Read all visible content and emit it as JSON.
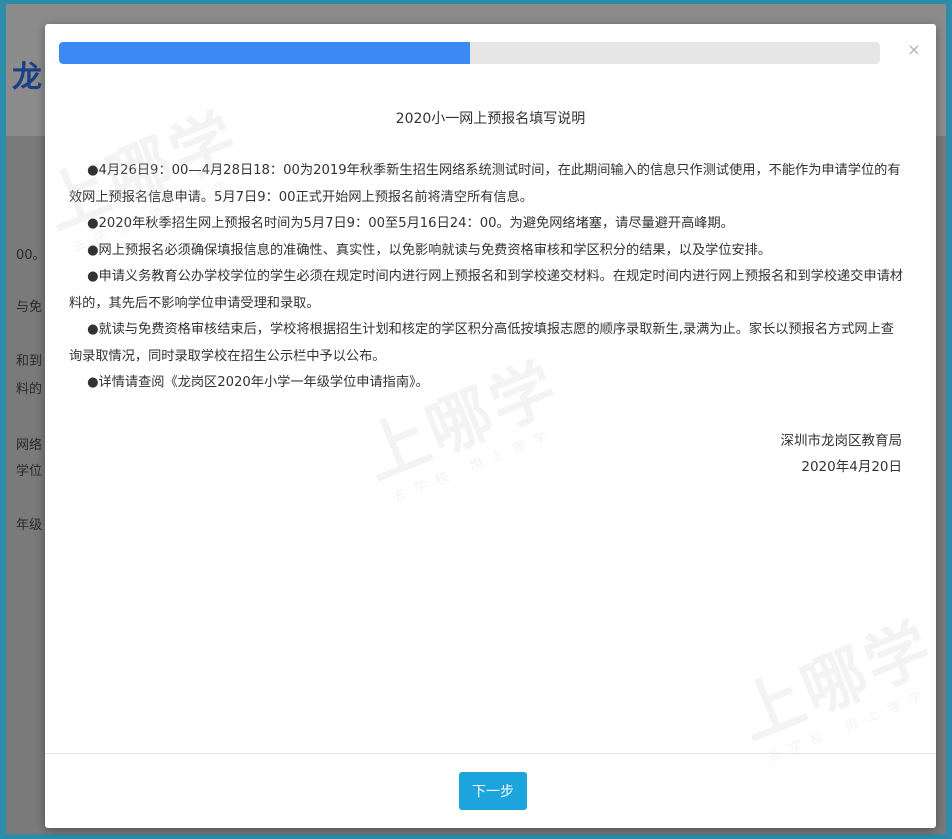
{
  "background": {
    "logo": "龙",
    "lines": [
      "00。",
      "与免",
      "和到",
      "料的",
      "网络",
      "学位",
      "年级"
    ]
  },
  "watermark": {
    "text": "上哪学",
    "subtext": "去学校 用上哪学"
  },
  "modal": {
    "progress_percent": 50,
    "close_symbol": "×",
    "title": "2020小一网上预报名填写说明",
    "paragraphs": [
      "●4月26日9：00—4月28日18：00为2019年秋季新生招生网络系统测试时间，在此期间输入的信息只作测试使用，不能作为申请学位的有效网上预报名信息申请。5月7日9：00正式开始网上预报名前将清空所有信息。",
      "●2020年秋季招生网上预报名时间为5月7日9：00至5月16日24：00。为避免网络堵塞，请尽量避开高峰期。",
      "●网上预报名必须确保填报信息的准确性、真实性，以免影响就读与免费资格审核和学区积分的结果，以及学位安排。",
      "●申请义务教育公办学校学位的学生必须在规定时间内进行网上预报名和到学校递交材料。在规定时间内进行网上预报名和到学校递交申请材料的，其先后不影响学位申请受理和录取。",
      "●就读与免费资格审核结束后，学校将根据招生计划和核定的学区积分高低按填报志愿的顺序录取新生,录满为止。家长以预报名方式网上查询录取情况，同时录取学校在招生公示栏中予以公布。",
      "●详情请查阅《龙岗区2020年小学一年级学位申请指南》。"
    ],
    "signature": {
      "org": "深圳市龙岗区教育局",
      "date": "2020年4月20日"
    },
    "next_label": "下一步"
  }
}
